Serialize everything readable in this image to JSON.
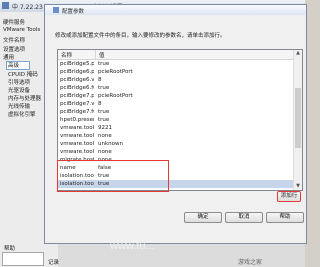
{
  "outer": {
    "title": "中 7.22.23 PT Flashmode - 虚拟机设置",
    "tree": [
      {
        "label": "硬件服务",
        "sub": false
      },
      {
        "label": "VMware Tools",
        "sub": false
      },
      {
        "label": "文件名称",
        "sub": false
      },
      {
        "label": "设置选项",
        "sub": false
      },
      {
        "label": "通用",
        "sub": true
      },
      {
        "label": "高级",
        "sub": true
      },
      {
        "label": "CPUID 掩码",
        "sub": true
      },
      {
        "label": "引导选项",
        "sub": true
      },
      {
        "label": "光驱设备",
        "sub": true
      },
      {
        "label": "内存与处理器",
        "sub": true
      },
      {
        "label": "光线传输",
        "sub": true
      },
      {
        "label": "虚拟化引擎",
        "sub": true
      }
    ],
    "bottom_left_label": "帮助",
    "bottom_mid_label": "记录"
  },
  "dialog": {
    "title": "配置参数",
    "description": "修改或添加配置文件中的条目，输入要修改的参数名，请单击添加行。",
    "columns": [
      "名称",
      "值"
    ],
    "rows": [
      {
        "name": "pciBridge5.pre...",
        "value": "true"
      },
      {
        "name": "pciBridge6.pre...",
        "value": "pcieRootPort"
      },
      {
        "name": "pciBridge6.vir...",
        "value": "8"
      },
      {
        "name": "pciBridge6.fun...",
        "value": "true"
      },
      {
        "name": "pciBridge7.pre...",
        "value": "pcieRootPort"
      },
      {
        "name": "pciBridge7.vir...",
        "value": "8"
      },
      {
        "name": "pciBridge7.fun...",
        "value": "true"
      },
      {
        "name": "hpet0.present",
        "value": "true"
      },
      {
        "name": "vmware.tools.i...",
        "value": "9221"
      },
      {
        "name": "vmware.tools.i...",
        "value": "none"
      },
      {
        "name": "vmware.tools.i...",
        "value": "unknown"
      },
      {
        "name": "vmware.tools.i...",
        "value": "none"
      },
      {
        "name": "migrate.hostlog...",
        "value": "none"
      },
      {
        "name": "name",
        "value": "false"
      },
      {
        "name": "isolation.tools...",
        "value": "true"
      },
      {
        "name": "isolation.tools...",
        "value": "true"
      }
    ],
    "add_button": "添加行",
    "ok_button": "确定",
    "cancel_button": "取消",
    "help_button": "帮助"
  },
  "watermarks": [
    "www.tu...",
    "游戏之家"
  ],
  "colors": {
    "highlight": "#e53935",
    "selected_row": "#c7d5ea"
  }
}
